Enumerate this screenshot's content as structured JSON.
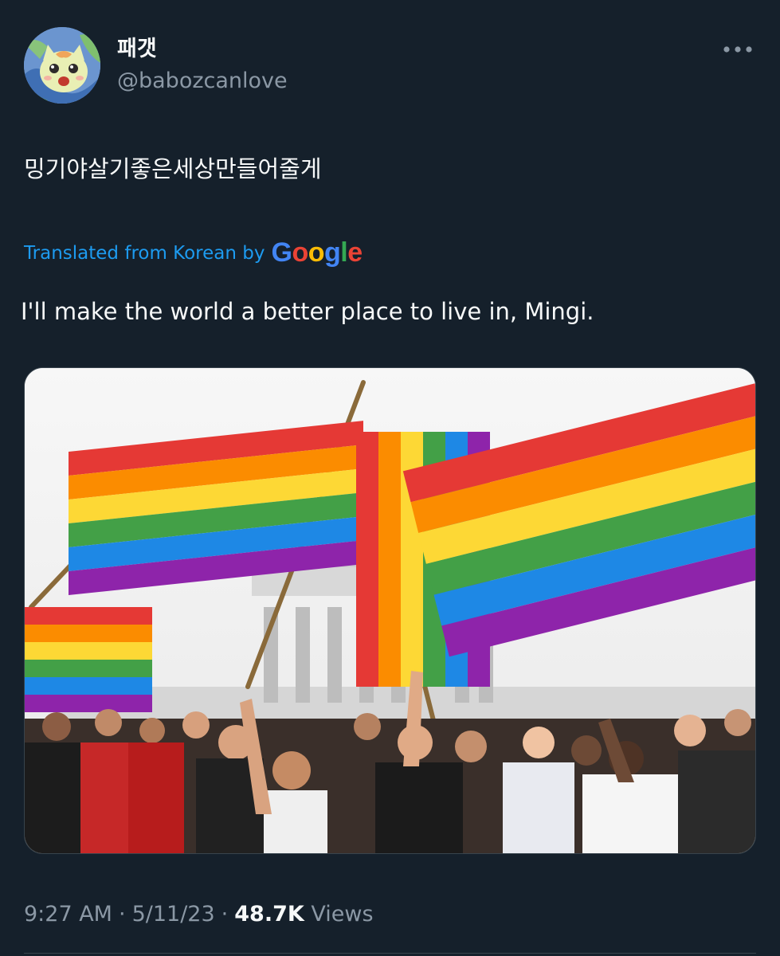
{
  "tweet": {
    "display_name": "패갯",
    "handle": "@babozcanlove",
    "avatar_icon": "cartoon-cat-avatar-icon",
    "more_icon": "more-options-icon",
    "text": "밍기야살기좋은세상만들어줄게",
    "translated_label": "Translated from Korean by",
    "translator": {
      "letters": [
        "G",
        "o",
        "o",
        "g",
        "l",
        "e"
      ],
      "colors": [
        "#4285f4",
        "#ea4335",
        "#fbbc05",
        "#4285f4",
        "#34a853",
        "#ea4335"
      ]
    },
    "translation": "I'll make the world a better place to live in, Mingi.",
    "time": "9:27 AM",
    "date": "5/11/23",
    "separator": "·",
    "views_count": "48.7K",
    "views_label": "Views"
  },
  "colors": {
    "background": "#15202b",
    "text_primary": "#f7f9f9",
    "text_secondary": "#8b98a5",
    "link": "#1d9bf0",
    "border": "#38444d"
  }
}
